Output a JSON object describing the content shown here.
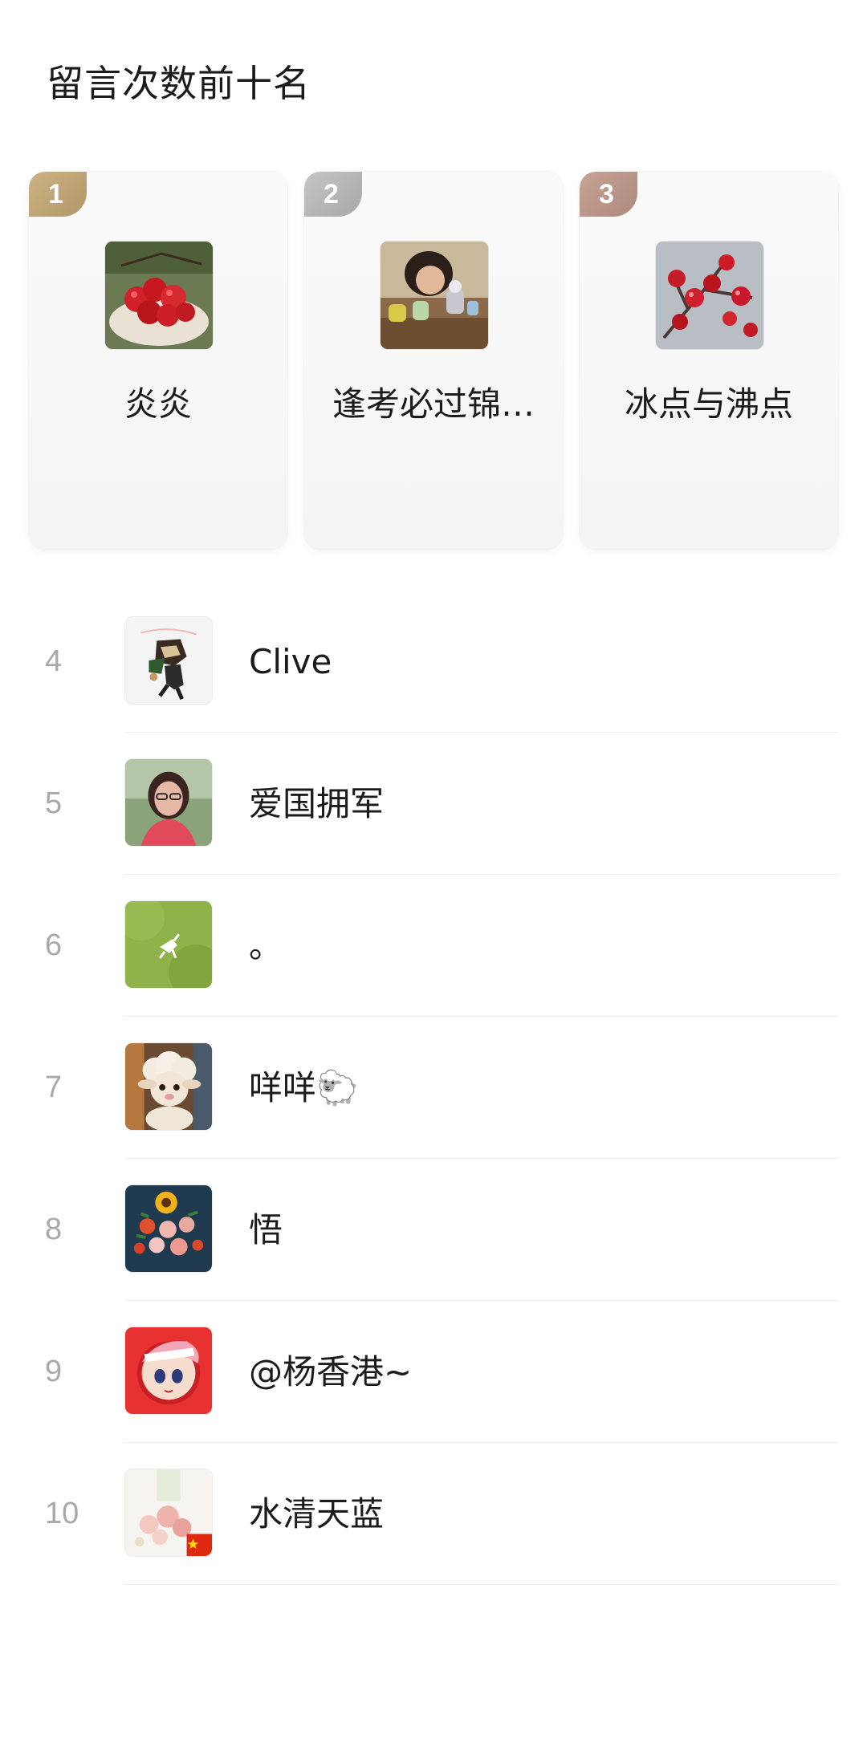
{
  "title": "留言次数前十名",
  "top3": [
    {
      "rank": "1",
      "name": "炎炎",
      "avatar": "cherries-photo-avatar"
    },
    {
      "rank": "2",
      "name": "逢考必过锦…",
      "avatar": "child-with-toys-photo-avatar"
    },
    {
      "rank": "3",
      "name": "冰点与沸点",
      "avatar": "red-berries-photo-avatar"
    }
  ],
  "list": [
    {
      "rank": "4",
      "name": "Clive",
      "avatar": "cartoon-figure-avatar"
    },
    {
      "rank": "5",
      "name": "爱国拥军",
      "avatar": "woman-portrait-avatar"
    },
    {
      "rank": "6",
      "name": "。",
      "avatar": "green-field-avatar"
    },
    {
      "rank": "7",
      "name": "咩咩🐑",
      "avatar": "sheep-avatar"
    },
    {
      "rank": "8",
      "name": "悟",
      "avatar": "sunflower-bouquet-avatar"
    },
    {
      "rank": "9",
      "name": "@杨香港~",
      "avatar": "anime-character-avatar"
    },
    {
      "rank": "10",
      "name": "水清天蓝",
      "avatar": "pink-flowers-flag-avatar"
    }
  ],
  "colors": {
    "gold_badge": "#b19868",
    "silver_badge": "#a8a8a8",
    "bronze_badge": "#ad8a7c",
    "rank_text": "#a9a9a9",
    "name_text": "#1b1b1b"
  }
}
